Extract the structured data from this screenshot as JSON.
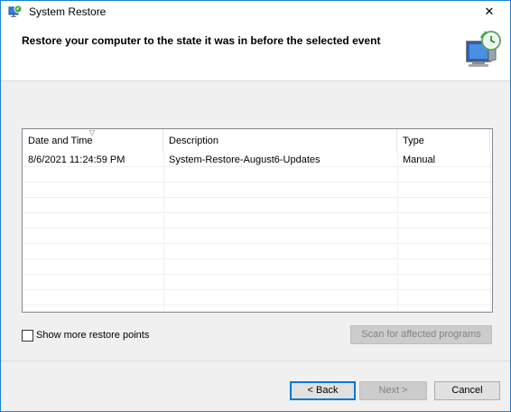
{
  "window": {
    "title": "System Restore",
    "close_glyph": "✕"
  },
  "header": {
    "instruction": "Restore your computer to the state it was in before the selected event",
    "icon": "system-restore-monitor-icon"
  },
  "table": {
    "columns": [
      "Date and Time",
      "Description",
      "Type"
    ],
    "rows": [
      [
        "8/6/2021 11:24:59 PM",
        "System-Restore-August6-Updates",
        "Manual"
      ]
    ],
    "sort_indicator": "▽"
  },
  "options": {
    "show_more_label": "Show more restore points",
    "show_more_checked": false
  },
  "buttons": {
    "scan_label": "Scan for affected programs",
    "back_label": "< Back",
    "next_label": "Next >",
    "cancel_label": "Cancel"
  },
  "colors": {
    "window_border": "#1883d7",
    "default_button_border": "#0078d7",
    "dialog_background": "#f0f0f0"
  }
}
